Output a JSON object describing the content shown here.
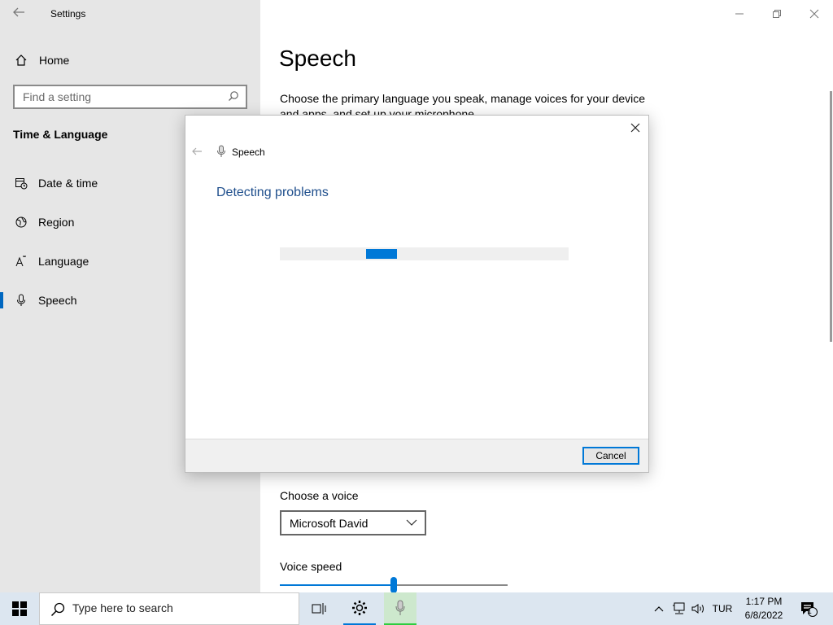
{
  "window": {
    "title": "Settings",
    "controls": {
      "minimize": "—",
      "maximize": "❐",
      "close": "✕"
    }
  },
  "sidebar": {
    "home_label": "Home",
    "search_placeholder": "Find a setting",
    "section_title": "Time & Language",
    "items": [
      {
        "label": "Date & time",
        "icon": "calendar-clock-icon",
        "selected": false
      },
      {
        "label": "Region",
        "icon": "globe-icon",
        "selected": false
      },
      {
        "label": "Language",
        "icon": "language-icon",
        "selected": false
      },
      {
        "label": "Speech",
        "icon": "microphone-icon",
        "selected": true
      }
    ]
  },
  "main": {
    "title": "Speech",
    "description": "Choose the primary language you speak, manage voices for your device and apps, and set up your microphone",
    "voice_label": "Choose a voice",
    "voice_selected": "Microsoft David",
    "speed_label": "Voice speed",
    "speed_value": 0.5
  },
  "dialog": {
    "title": "Speech",
    "heading": "Detecting problems",
    "progress_state": "indeterminate",
    "cancel_label": "Cancel"
  },
  "taskbar": {
    "search_placeholder": "Type here to search",
    "language": "TUR",
    "time": "1:17 PM",
    "date": "6/8/2022",
    "notification_count": "1"
  },
  "colors": {
    "accent": "#0078d7",
    "sidebar_bg": "#e6e6e6",
    "dialog_heading": "#1e4e8c",
    "taskbar_bg": "#dce6f0"
  }
}
